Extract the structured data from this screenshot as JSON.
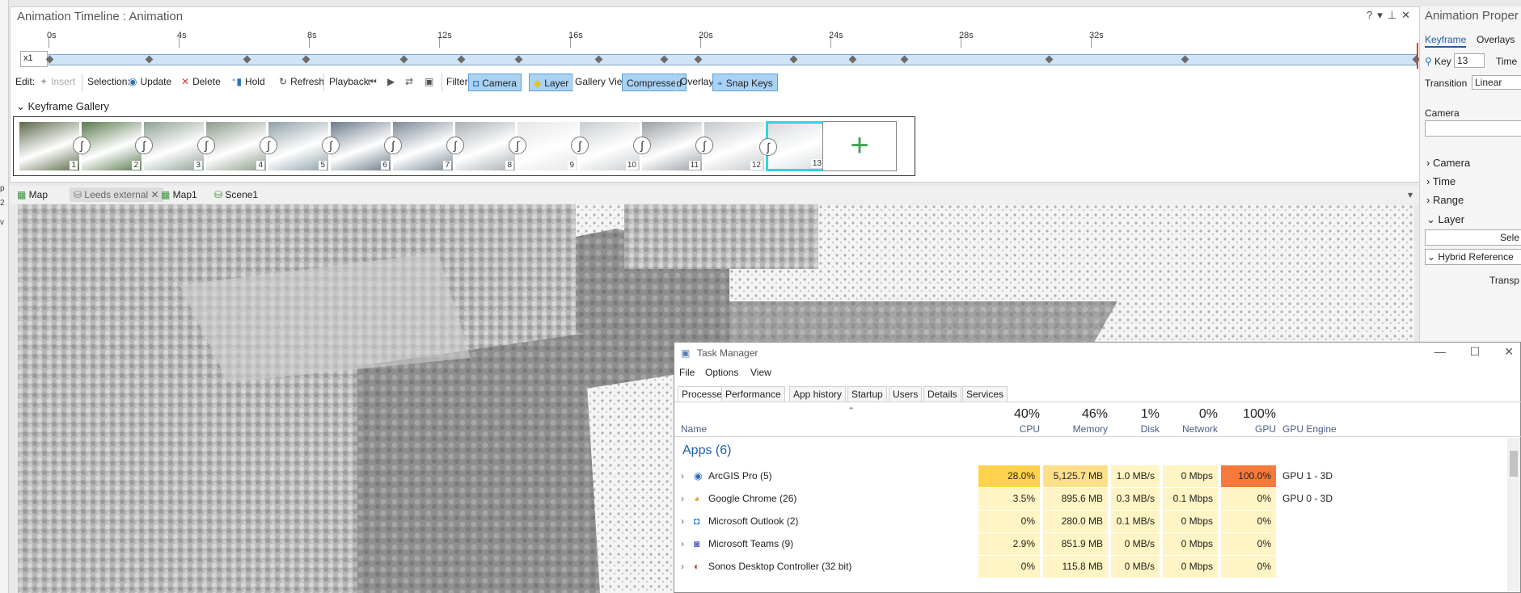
{
  "left_sliver": {
    "chars": [
      "p",
      "2",
      "v"
    ]
  },
  "animation_timeline": {
    "title": "Animation Timeline : Animation",
    "window_controls": [
      "?",
      "▾",
      "⊥",
      "✕"
    ],
    "speed": "x1",
    "time_labels": [
      "0s",
      "4s",
      "8s",
      "12s",
      "16s",
      "20s",
      "24s",
      "28s",
      "32s"
    ],
    "keyframe_count": 18
  },
  "toolbar": {
    "edit_label": "Edit:",
    "insert_label": "Insert",
    "selection_label": "Selection:",
    "update_label": "Update",
    "delete_label": "Delete",
    "hold_label": "Hold",
    "refresh_label": "Refresh",
    "playback_label": "Playback:",
    "filter_label": "Filter:",
    "camera_label": "Camera",
    "layer_label": "Layer",
    "gallery_view_label": "Gallery View:",
    "compressed_label": "Compressed",
    "overlay_label": "Overlay:",
    "snap_keys_label": "Snap Keys"
  },
  "gallery": {
    "title": "Keyframe Gallery",
    "thumbnails": [
      "1",
      "2",
      "3",
      "4",
      "5",
      "6",
      "7",
      "8",
      "9",
      "10",
      "11",
      "12",
      "13"
    ],
    "add_symbol": "+"
  },
  "map_tabs": [
    {
      "label": "Map"
    },
    {
      "label": "Leeds external",
      "close": "✕"
    },
    {
      "label": "Map1"
    },
    {
      "label": "Scene1"
    }
  ],
  "properties_panel": {
    "title": "Animation Proper",
    "tabs": [
      "Keyframe",
      "Overlays"
    ],
    "key_label": "Key",
    "key_value": "13",
    "time_label": "Time",
    "transition_label": "Transition",
    "transition_value": "Linear",
    "camera_label": "Camera",
    "sections": [
      "Camera",
      "Time",
      "Range",
      "Layer"
    ],
    "select_button": "Sele",
    "hybrid_label": "Hybrid Reference",
    "transp_label": "Transp"
  },
  "task_manager": {
    "title": "Task Manager",
    "window_controls": [
      "—",
      "☐",
      "✕"
    ],
    "menu": [
      "File",
      "Options",
      "View"
    ],
    "tabs": [
      "Processes",
      "Performance",
      "App history",
      "Startup",
      "Users",
      "Details",
      "Services"
    ],
    "columns": {
      "name": "Name",
      "cpu": {
        "label": "CPU",
        "pct": "40%"
      },
      "memory": {
        "label": "Memory",
        "pct": "46%"
      },
      "disk": {
        "label": "Disk",
        "pct": "1%"
      },
      "network": {
        "label": "Network",
        "pct": "0%"
      },
      "gpu": {
        "label": "GPU",
        "pct": "100%"
      },
      "gpu_engine": "GPU Engine"
    },
    "group_label": "Apps (6)",
    "rows": [
      {
        "name": "ArcGIS Pro (5)",
        "cpu": "28.0%",
        "memory": "5,125.7 MB",
        "disk": "1.0 MB/s",
        "network": "0 Mbps",
        "gpu": "100.0%",
        "gpu_engine": "GPU 1 - 3D"
      },
      {
        "name": "Google Chrome (26)",
        "cpu": "3.5%",
        "memory": "895.6 MB",
        "disk": "0.3 MB/s",
        "network": "0.1 Mbps",
        "gpu": "0%",
        "gpu_engine": "GPU 0 - 3D"
      },
      {
        "name": "Microsoft Outlook (2)",
        "cpu": "0%",
        "memory": "280.0 MB",
        "disk": "0.1 MB/s",
        "network": "0 Mbps",
        "gpu": "0%",
        "gpu_engine": ""
      },
      {
        "name": "Microsoft Teams (9)",
        "cpu": "2.9%",
        "memory": "851.9 MB",
        "disk": "0 MB/s",
        "network": "0 Mbps",
        "gpu": "0%",
        "gpu_engine": ""
      },
      {
        "name": "Sonos Desktop Controller (32 bit)",
        "cpu": "0%",
        "memory": "115.8 MB",
        "disk": "0 MB/s",
        "network": "0 Mbps",
        "gpu": "0%",
        "gpu_engine": ""
      }
    ]
  }
}
